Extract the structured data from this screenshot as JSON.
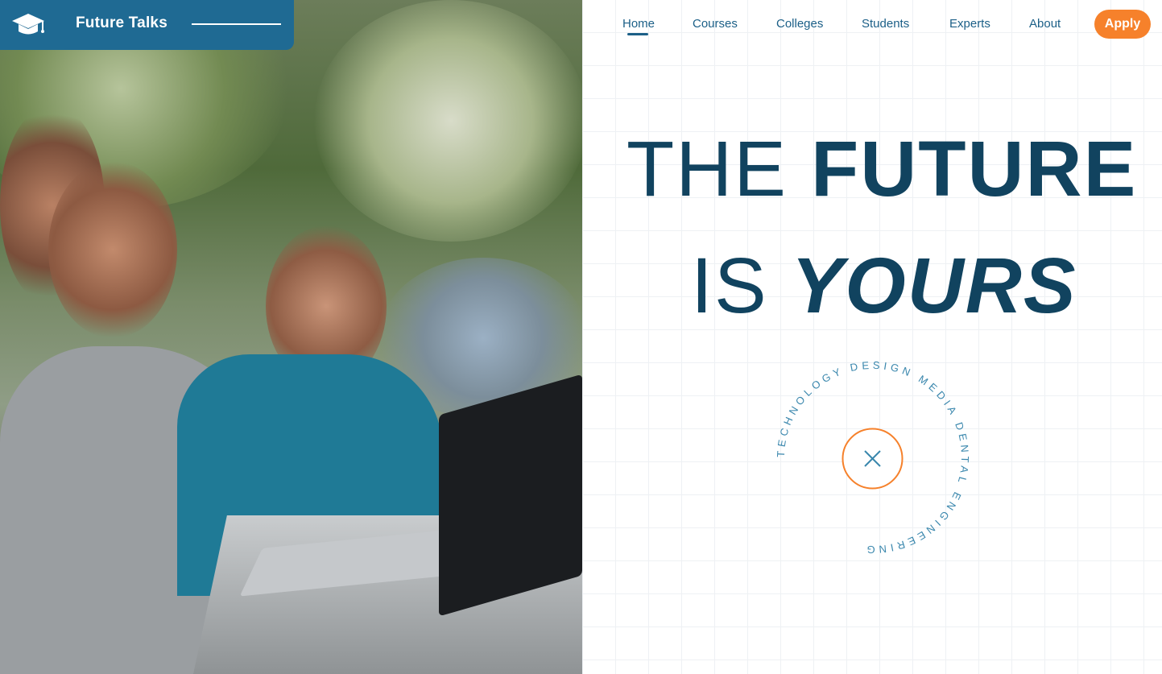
{
  "brand": {
    "name": "Future Talks",
    "logo_icon": "graduation-cap-icon"
  },
  "nav": {
    "items": [
      "Home",
      "Courses",
      "Colleges",
      "Students",
      "Experts",
      "About"
    ],
    "active": "Home",
    "apply_label": "Apply"
  },
  "hero": {
    "line1_thin": "THE",
    "line1_bold": "FUTURE",
    "line2_thin": "IS",
    "line2_bold": "YOURS",
    "image_alt_icon": "students-with-laptop-photo"
  },
  "circle_badge": {
    "text": "TECHNOLOGY DESIGN MEDIA DENTAL ENGINEERING",
    "center_icon": "close-icon"
  },
  "colors": {
    "brand": "#1f6a93",
    "accent": "#f6812b",
    "headline": "#11435f",
    "nav": "#1b5f87",
    "badge_text": "#3a87ad"
  }
}
